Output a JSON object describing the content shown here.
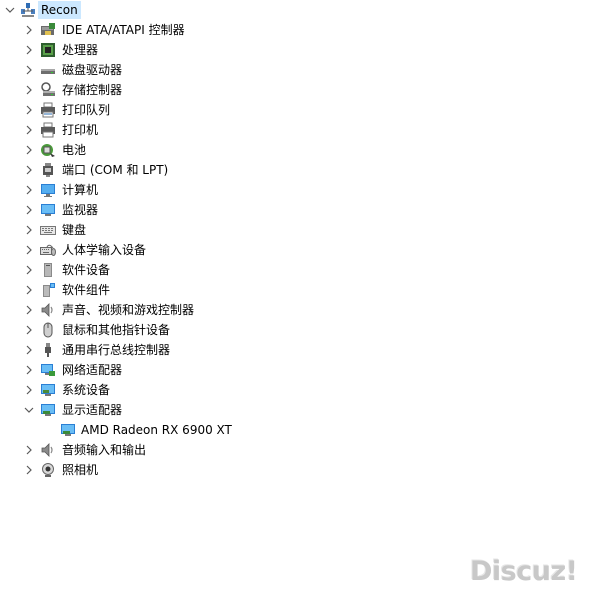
{
  "root": {
    "label": "Recon",
    "expanded": true,
    "icon": "computer-root-icon"
  },
  "categories": [
    {
      "label": "IDE ATA/ATAPI 控制器",
      "icon": "ide-controller-icon",
      "expanded": false
    },
    {
      "label": "处理器",
      "icon": "processor-icon",
      "expanded": false
    },
    {
      "label": "磁盘驱动器",
      "icon": "disk-drive-icon",
      "expanded": false
    },
    {
      "label": "存储控制器",
      "icon": "storage-controller-icon",
      "expanded": false
    },
    {
      "label": "打印队列",
      "icon": "print-queue-icon",
      "expanded": false
    },
    {
      "label": "打印机",
      "icon": "printer-icon",
      "expanded": false
    },
    {
      "label": "电池",
      "icon": "battery-icon",
      "expanded": false
    },
    {
      "label": "端口 (COM 和 LPT)",
      "icon": "port-icon",
      "expanded": false
    },
    {
      "label": "计算机",
      "icon": "computer-icon",
      "expanded": false
    },
    {
      "label": "监视器",
      "icon": "monitor-icon",
      "expanded": false
    },
    {
      "label": "键盘",
      "icon": "keyboard-icon",
      "expanded": false
    },
    {
      "label": "人体学输入设备",
      "icon": "hid-icon",
      "expanded": false
    },
    {
      "label": "软件设备",
      "icon": "software-device-icon",
      "expanded": false
    },
    {
      "label": "软件组件",
      "icon": "software-component-icon",
      "expanded": false
    },
    {
      "label": "声音、视频和游戏控制器",
      "icon": "speaker-icon",
      "expanded": false
    },
    {
      "label": "鼠标和其他指针设备",
      "icon": "mouse-icon",
      "expanded": false
    },
    {
      "label": "通用串行总线控制器",
      "icon": "usb-icon",
      "expanded": false
    },
    {
      "label": "网络适配器",
      "icon": "network-adapter-icon",
      "expanded": false
    },
    {
      "label": "系统设备",
      "icon": "system-device-icon",
      "expanded": false
    },
    {
      "label": "显示适配器",
      "icon": "display-adapter-icon",
      "expanded": true,
      "children": [
        {
          "label": "AMD Radeon RX 6900 XT",
          "icon": "display-adapter-icon"
        }
      ]
    },
    {
      "label": "音频输入和输出",
      "icon": "audio-io-icon",
      "expanded": false
    },
    {
      "label": "照相机",
      "icon": "camera-icon",
      "expanded": false
    }
  ],
  "watermark": "Discuz!",
  "colors": {
    "selection": "#cce8ff",
    "chevron": "#5a5a5a",
    "watermark": "#c8c8c8"
  }
}
